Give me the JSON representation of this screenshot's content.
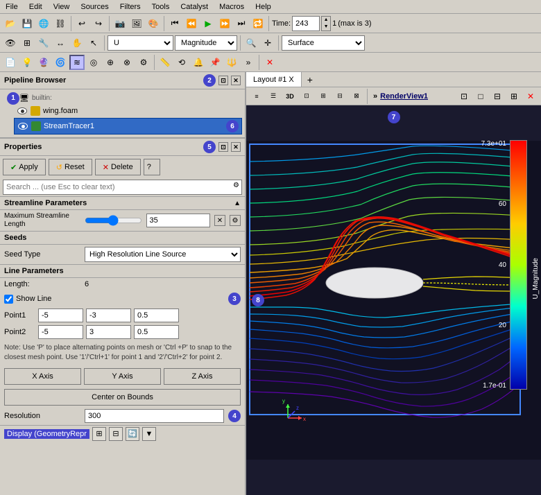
{
  "menubar": {
    "items": [
      "File",
      "Edit",
      "View",
      "Sources",
      "Filters",
      "Tools",
      "Catalyst",
      "Macros",
      "Help"
    ]
  },
  "toolbar": {
    "time_label": "Time:",
    "time_value": "243",
    "time_max": "(max is 3)",
    "time_steps": "1",
    "field_value": "U",
    "field_type": "Magnitude",
    "surface_label": "Surface"
  },
  "pipeline_browser": {
    "title": "Pipeline Browser",
    "builtin_label": "builtin:",
    "wing_item": "wing.foam",
    "stream_item": "StreamTracer1"
  },
  "properties": {
    "title": "Properties",
    "apply_label": "Apply",
    "reset_label": "Reset",
    "delete_label": "Delete",
    "search_placeholder": "Search ... (use Esc to clear text)",
    "section_streamline": "Streamline Parameters",
    "max_length_label": "Maximum Streamline\nLength",
    "max_length_value": "35",
    "section_seeds": "Seeds",
    "seed_type_label": "Seed Type",
    "seed_type_value": "High Resolution Line Source",
    "section_line": "Line Parameters",
    "length_label": "Length:",
    "length_value": "6",
    "show_line_label": "Show Line",
    "point1_label": "Point1",
    "point1_x": "-5",
    "point1_y": "-3",
    "point1_z": "0.5",
    "point2_label": "Point2",
    "point2_x": "-5",
    "point2_y": "3",
    "point2_z": "0.5",
    "note_text": "Note: Use 'P' to place alternating points on mesh or 'Ctrl +P' to snap to the closest mesh point. Use '1'/'Ctrl+1' for point 1 and '2'/'Ctrl+2' for point 2.",
    "x_axis_label": "X Axis",
    "y_axis_label": "Y Axis",
    "z_axis_label": "Z Axis",
    "center_bounds_label": "Center on Bounds",
    "resolution_label": "Resolution",
    "resolution_value": "300",
    "display_label": "Display (GeometryRepr"
  },
  "render_view": {
    "tab_label": "Layout #1 X",
    "view_label": "RenderView1",
    "colorbar": {
      "max_label": "7.3e+01",
      "val60": "60",
      "val40": "40",
      "val20": "20",
      "min_label": "1.7e-01",
      "title": "U_Magnitude"
    }
  },
  "badges": {
    "b1": "1",
    "b2": "2",
    "b3": "3",
    "b4": "4",
    "b5": "5",
    "b6": "6",
    "b7": "7",
    "b8": "8"
  }
}
